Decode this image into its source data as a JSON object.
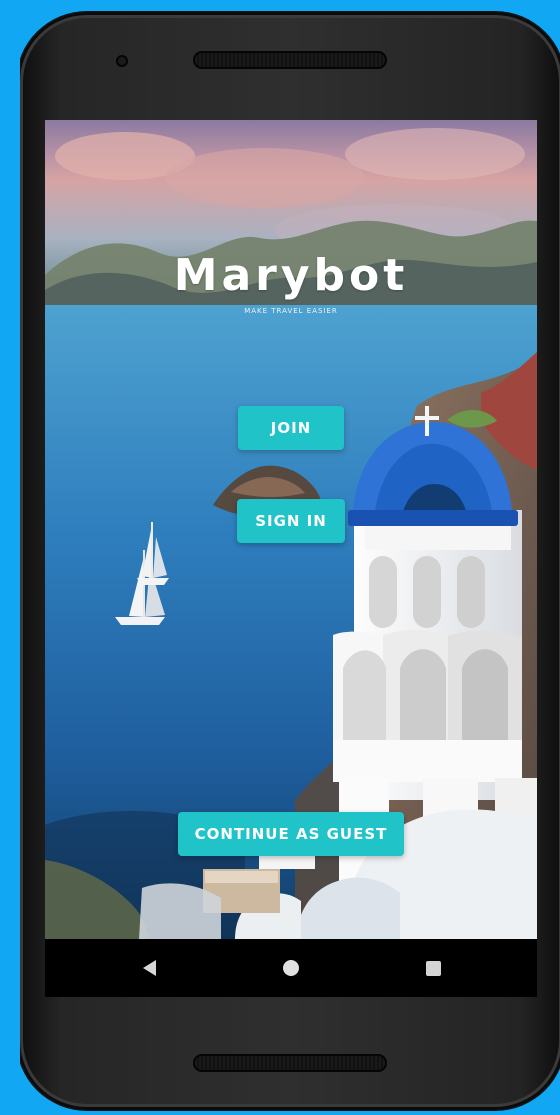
{
  "app": {
    "title": "Marybot",
    "tagline": "MAKE TRAVEL EASIER"
  },
  "actions": {
    "join_label": "JOIN",
    "sign_in_label": "SIGN IN",
    "guest_label": "CONTINUE AS GUEST"
  },
  "navigation": {
    "back_icon": "back-icon",
    "home_icon": "home-icon",
    "recents_icon": "recents-icon"
  },
  "colors": {
    "primary_button": "#1fc3c8",
    "page_background": "#12a7f2",
    "device_frame": "#2f2f2f"
  }
}
